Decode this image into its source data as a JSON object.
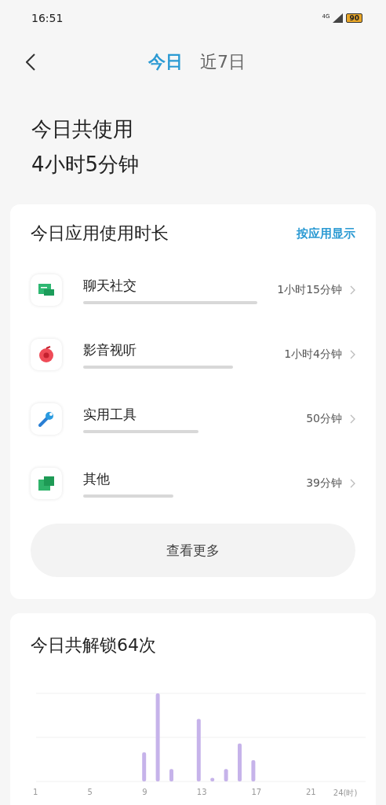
{
  "status_bar": {
    "time": "16:51",
    "network": "4G",
    "battery": "90"
  },
  "tabs": [
    {
      "label": "今日",
      "selected": true
    },
    {
      "label": "近7日",
      "selected": false
    }
  ],
  "summary": {
    "label": "今日共使用",
    "value": "4小时5分钟"
  },
  "usage_card": {
    "title": "今日应用使用时长",
    "toggle": "按应用显示",
    "categories": [
      {
        "kind": "chat",
        "name": "聊天社交",
        "time": "1小时15分钟"
      },
      {
        "kind": "media",
        "name": "影音视听",
        "time": "1小时4分钟"
      },
      {
        "kind": "tools",
        "name": "实用工具",
        "time": "50分钟"
      },
      {
        "kind": "other",
        "name": "其他",
        "time": "39分钟"
      }
    ],
    "more_button": "查看更多"
  },
  "unlock_card": {
    "title": "今日共解锁64次",
    "x_labels": [
      "1",
      "5",
      "9",
      "13",
      "17",
      "21",
      "24(时)"
    ]
  }
}
